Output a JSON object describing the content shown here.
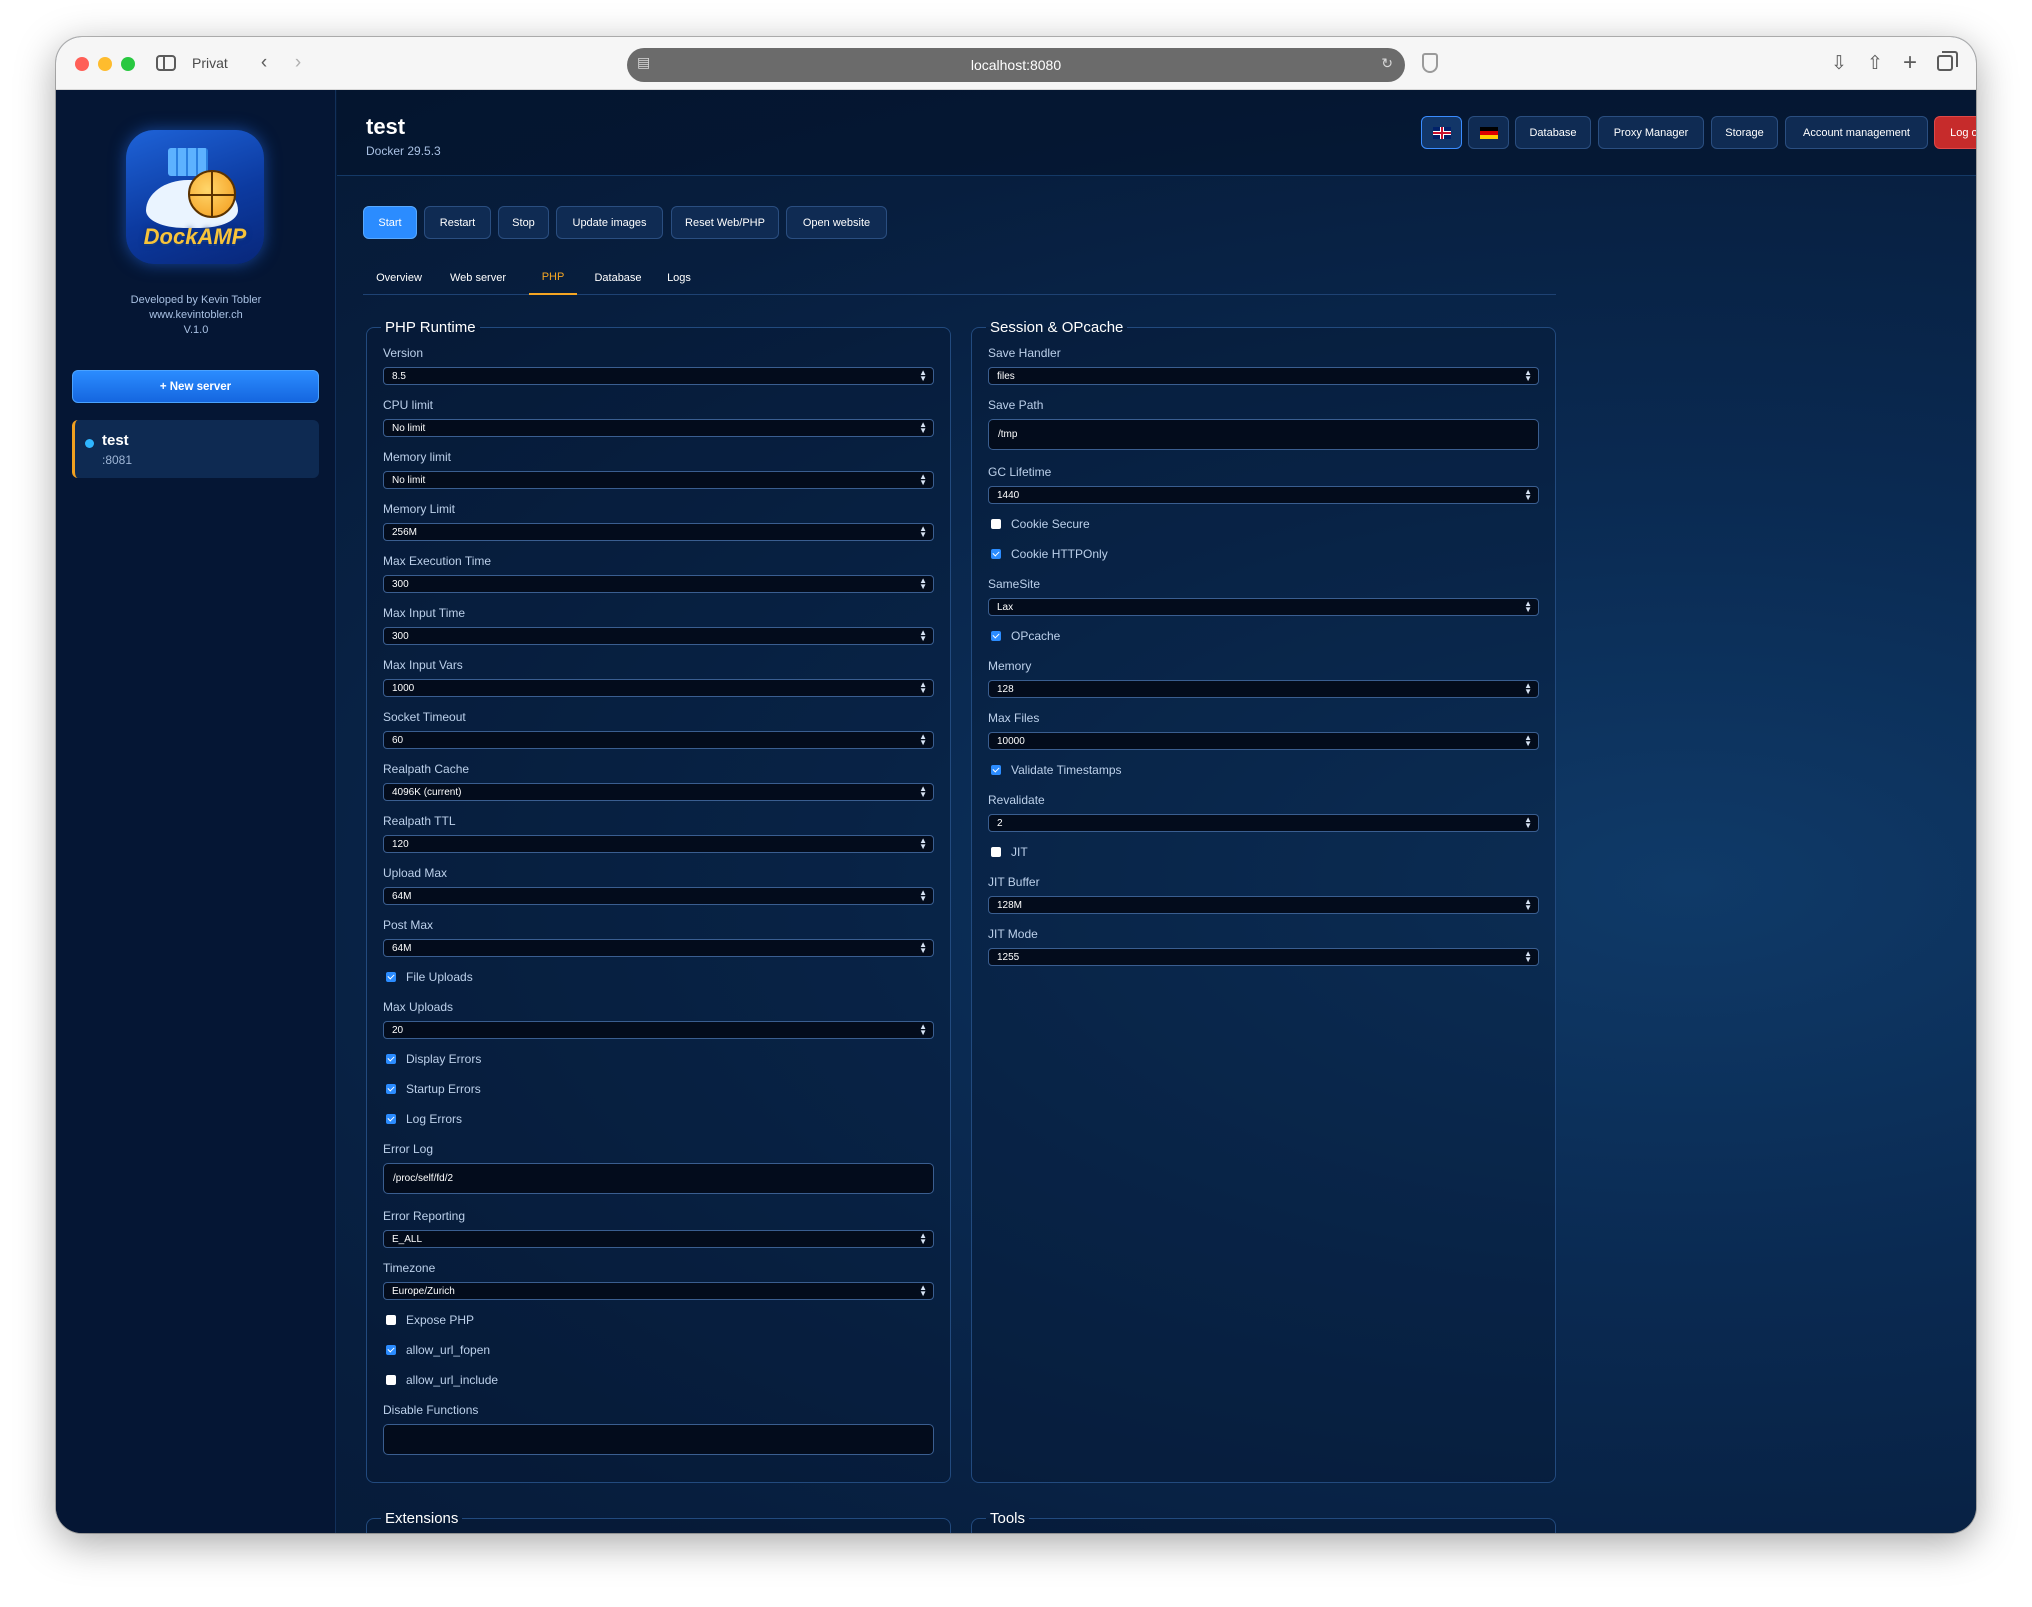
{
  "browser": {
    "mode_label": "Privat",
    "url": "localhost:8080"
  },
  "sidebar": {
    "brand": "DockAMP",
    "developer": "Developed by Kevin Tobler",
    "website": "www.kevintobler.ch",
    "version": "V.1.0",
    "new_server_label": "+ New server",
    "servers": [
      {
        "name": "test",
        "port": ":8081",
        "status_color": "#2fb6ff"
      }
    ]
  },
  "header": {
    "title": "test",
    "subtitle": "Docker 29.5.3",
    "buttons": {
      "database": "Database",
      "proxy": "Proxy Manager",
      "storage": "Storage",
      "account": "Account management",
      "logout": "Log out"
    }
  },
  "actions": {
    "start": "Start",
    "restart": "Restart",
    "stop": "Stop",
    "update": "Update images",
    "reset": "Reset Web/PHP",
    "open": "Open website"
  },
  "tabs": {
    "overview": "Overview",
    "webserver": "Web server",
    "php": "PHP",
    "database": "Database",
    "logs": "Logs"
  },
  "php_runtime": {
    "title": "PHP Runtime",
    "version": {
      "label": "Version",
      "value": "8.5"
    },
    "cpu_limit": {
      "label": "CPU limit",
      "value": "No limit"
    },
    "memory_limit_container": {
      "label": "Memory limit",
      "value": "No limit"
    },
    "memory_limit": {
      "label": "Memory Limit",
      "value": "256M"
    },
    "max_execution_time": {
      "label": "Max Execution Time",
      "value": "300"
    },
    "max_input_time": {
      "label": "Max Input Time",
      "value": "300"
    },
    "max_input_vars": {
      "label": "Max Input Vars",
      "value": "1000"
    },
    "socket_timeout": {
      "label": "Socket Timeout",
      "value": "60"
    },
    "realpath_cache": {
      "label": "Realpath Cache",
      "value": "4096K (current)"
    },
    "realpath_ttl": {
      "label": "Realpath TTL",
      "value": "120"
    },
    "upload_max": {
      "label": "Upload Max",
      "value": "64M"
    },
    "post_max": {
      "label": "Post Max",
      "value": "64M"
    },
    "file_uploads": {
      "label": "File Uploads",
      "checked": true
    },
    "max_uploads": {
      "label": "Max Uploads",
      "value": "20"
    },
    "display_errors": {
      "label": "Display Errors",
      "checked": true
    },
    "startup_errors": {
      "label": "Startup Errors",
      "checked": true
    },
    "log_errors": {
      "label": "Log Errors",
      "checked": true
    },
    "error_log": {
      "label": "Error Log",
      "value": "/proc/self/fd/2"
    },
    "error_reporting": {
      "label": "Error Reporting",
      "value": "E_ALL"
    },
    "timezone": {
      "label": "Timezone",
      "value": "Europe/Zurich"
    },
    "expose_php": {
      "label": "Expose PHP",
      "checked": false
    },
    "allow_url_fopen": {
      "label": "allow_url_fopen",
      "checked": true
    },
    "allow_url_include": {
      "label": "allow_url_include",
      "checked": false
    },
    "disable_functions": {
      "label": "Disable Functions",
      "value": ""
    }
  },
  "session_opcache": {
    "title": "Session & OPcache",
    "save_handler": {
      "label": "Save Handler",
      "value": "files"
    },
    "save_path": {
      "label": "Save Path",
      "value": "/tmp"
    },
    "gc_lifetime": {
      "label": "GC Lifetime",
      "value": "1440"
    },
    "cookie_secure": {
      "label": "Cookie Secure",
      "checked": false
    },
    "cookie_httponly": {
      "label": "Cookie HTTPOnly",
      "checked": true
    },
    "samesite": {
      "label": "SameSite",
      "value": "Lax"
    },
    "opcache": {
      "label": "OPcache",
      "checked": true
    },
    "memory": {
      "label": "Memory",
      "value": "128"
    },
    "max_files": {
      "label": "Max Files",
      "value": "10000"
    },
    "validate_timestamps": {
      "label": "Validate Timestamps",
      "checked": true
    },
    "revalidate": {
      "label": "Revalidate",
      "value": "2"
    },
    "jit": {
      "label": "JIT",
      "checked": false
    },
    "jit_buffer": {
      "label": "JIT Buffer",
      "value": "128M"
    },
    "jit_mode": {
      "label": "JIT Mode",
      "value": "1255"
    }
  },
  "extensions": {
    "title": "Extensions"
  },
  "tools": {
    "title": "Tools"
  },
  "colors": {
    "accent": "#2b8cff",
    "active_tab": "#f5a623",
    "logout": "#c62b2b",
    "background": "#061a36"
  }
}
